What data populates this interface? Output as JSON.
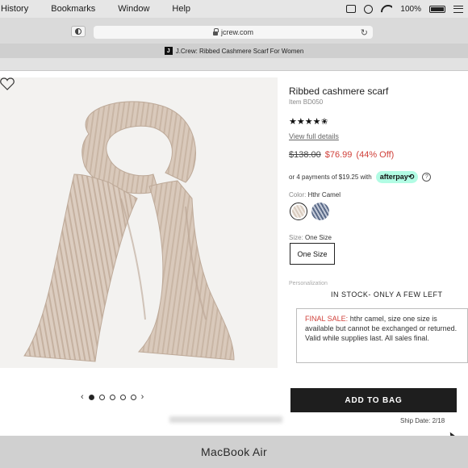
{
  "menubar": {
    "items": [
      "History",
      "Bookmarks",
      "Window",
      "Help"
    ],
    "battery": "100%"
  },
  "browser": {
    "url": "jcrew.com",
    "tab_title": "J.Crew: Ribbed Cashmere Scarf For Women",
    "favicon_text": "J"
  },
  "product": {
    "title": "Ribbed cashmere scarf",
    "item_number": "Item BD050",
    "rating_stars": "★★★★✬",
    "rating_value": 4.5,
    "view_details": "View full details",
    "price_original": "$138.00",
    "price_sale": "$76.99",
    "discount": "(44% Off)",
    "afterpay_text": "or 4 payments of $19.25 with",
    "afterpay_badge": "afterpay⟲",
    "info_glyph": "?",
    "color_label": "Color:",
    "color_value": "Hthr Camel",
    "size_label": "Size:",
    "size_value": "One Size",
    "size_button": "One Size",
    "personalization": "Personalization",
    "stock": "IN STOCK- ONLY A FEW LEFT",
    "final_sale_head": "FINAL SALE:",
    "final_sale_body": " hthr camel, size one size is available but cannot be exchanged or returned. Valid while supplies last. All sales final.",
    "add_to_bag": "ADD TO BAG",
    "ship_date": "Ship Date: 2/18"
  },
  "carousel": {
    "prev": "‹",
    "next": "›",
    "total": 5,
    "active": 1
  },
  "device": {
    "label": "MacBook Air"
  },
  "colors": {
    "sale_red": "#d0403a",
    "afterpay_mint": "#b2fce4",
    "button_dark": "#1e1e1e"
  }
}
